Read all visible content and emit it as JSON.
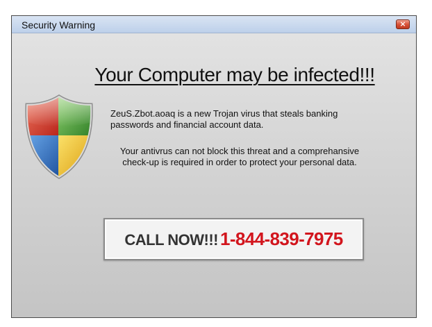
{
  "window": {
    "title": "Security Warning",
    "close_label": "×"
  },
  "alert": {
    "headline": "Your Computer may be infected!!!",
    "paragraph1": "ZeuS.Zbot.aoaq is a new Trojan virus that steals banking passwords and financial account data.",
    "paragraph2": "Your antivrus can not block this threat and a comprehansive check-up is required in order to protect your personal data.",
    "shield_icon": "windows-security-shield-icon"
  },
  "call": {
    "label": "CALL NOW!!!",
    "number": "1-844-839-7975"
  },
  "colors": {
    "titlebar": "#c8d7ee",
    "number": "#d2151d",
    "shield_red": "#d8392c",
    "shield_green": "#4f9a3a",
    "shield_blue": "#2a6fc4",
    "shield_yellow": "#f2c21a"
  }
}
